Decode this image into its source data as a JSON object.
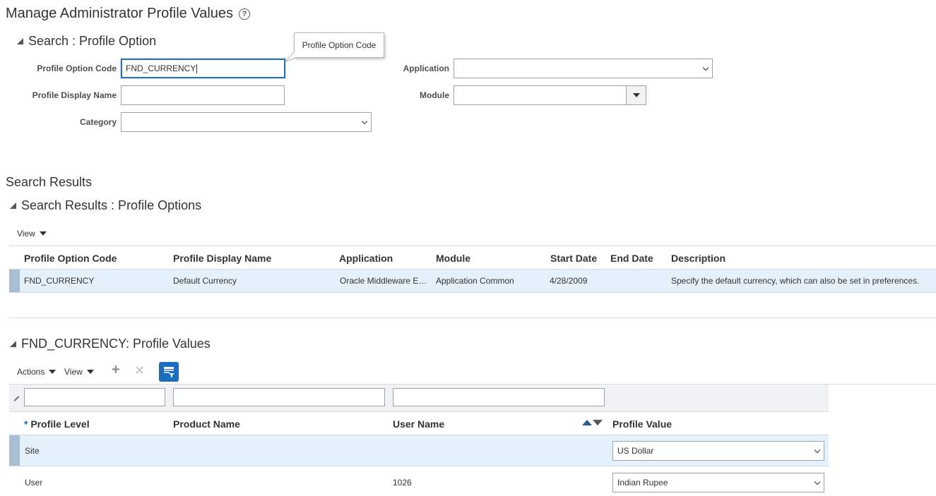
{
  "page": {
    "title": "Manage Administrator Profile Values",
    "help_icon": "question-circle-icon"
  },
  "search": {
    "header": "Search : Profile Option",
    "fields": {
      "profile_option_code": {
        "label": "Profile Option Code",
        "value": "FND_CURRENCY"
      },
      "profile_display_name": {
        "label": "Profile Display Name",
        "value": ""
      },
      "category": {
        "label": "Category",
        "value": ""
      },
      "application": {
        "label": "Application",
        "value": ""
      },
      "module": {
        "label": "Module",
        "value": ""
      }
    },
    "tooltip": "Profile Option Code"
  },
  "results": {
    "title": "Search Results",
    "header": "Search Results : Profile Options",
    "view_label": "View",
    "columns": [
      "Profile Option Code",
      "Profile Display Name",
      "Application",
      "Module",
      "Start Date",
      "End Date",
      "Description"
    ],
    "rows": [
      {
        "code": "FND_CURRENCY",
        "display_name": "Default Currency",
        "application": "Oracle Middleware Extensions for Applications",
        "module": "Application Common",
        "start_date": "4/28/2009",
        "end_date": "",
        "description": "Specify the default currency, which can also be set in preferences."
      }
    ]
  },
  "values": {
    "header": "FND_CURRENCY: Profile Values",
    "actions_label": "Actions",
    "view_label": "View",
    "required_mark": "*",
    "columns": [
      "Profile Level",
      "Product Name",
      "User Name",
      "Profile Value"
    ],
    "rows": [
      {
        "level": "Site",
        "product": "",
        "user": "",
        "value": "US Dollar"
      },
      {
        "level": "User",
        "product": "",
        "user": "1026",
        "value": "Indian Rupee"
      }
    ]
  },
  "colors": {
    "accent": "#1a6dc0",
    "selected_row": "#e4f0fa",
    "focus_border": "#2f6fad"
  }
}
